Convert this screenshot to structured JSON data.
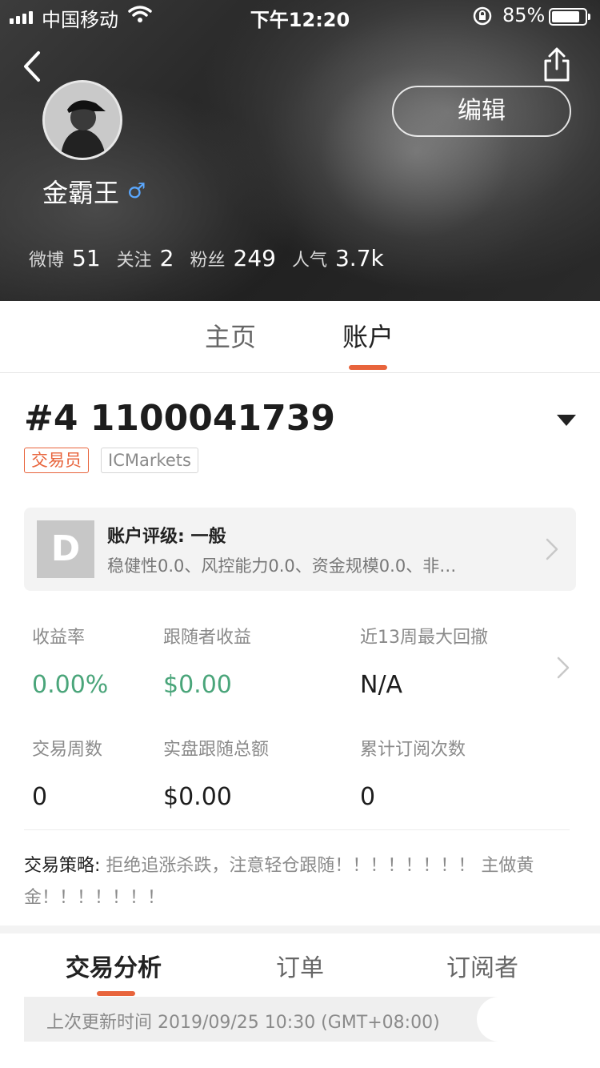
{
  "status_bar": {
    "carrier": "中国移动",
    "time": "下午12:20",
    "battery_pct": "85%",
    "battery_level": 0.85
  },
  "profile": {
    "username": "金霸王",
    "gender_icon": "♂",
    "edit_label": "编辑",
    "stats": [
      {
        "label": "微博",
        "value": "51"
      },
      {
        "label": "关注",
        "value": "2"
      },
      {
        "label": "粉丝",
        "value": "249"
      },
      {
        "label": "人气",
        "value": "3.7k"
      }
    ]
  },
  "tabs": [
    {
      "label": "主页",
      "active": false
    },
    {
      "label": "账户",
      "active": true
    }
  ],
  "account": {
    "title": "#4 1100041739",
    "tags": [
      "交易员",
      "ICMarkets"
    ],
    "rating": {
      "grade": "D",
      "title": "账户评级: 一般",
      "detail": "稳健性0.0、风控能力0.0、资金规模0.0、非…"
    },
    "metrics": [
      {
        "label": "收益率",
        "value": "0.00%"
      },
      {
        "label": "跟随者收益",
        "value": "$0.00"
      },
      {
        "label": "近13周最大回撤",
        "value": "N/A"
      },
      {
        "label": "交易周数",
        "value": "0"
      },
      {
        "label": "实盘跟随总额",
        "value": "$0.00"
      },
      {
        "label": "累计订阅次数",
        "value": "0"
      }
    ],
    "strategy_label": "交易策略:",
    "strategy_text": " 拒绝追涨杀跌，注意轻仓跟随！！！！！！！！ 主做黄金！！！！！！！"
  },
  "sub_tabs": [
    {
      "label": "交易分析",
      "active": true
    },
    {
      "label": "订单",
      "active": false
    },
    {
      "label": "订阅者",
      "active": false
    }
  ],
  "update_text": "上次更新时间 2019/09/25 10:30 (GMT+08:00)",
  "colors": {
    "accent": "#e8643c",
    "positive": "#4aa57a",
    "gender": "#5aa8ff"
  }
}
